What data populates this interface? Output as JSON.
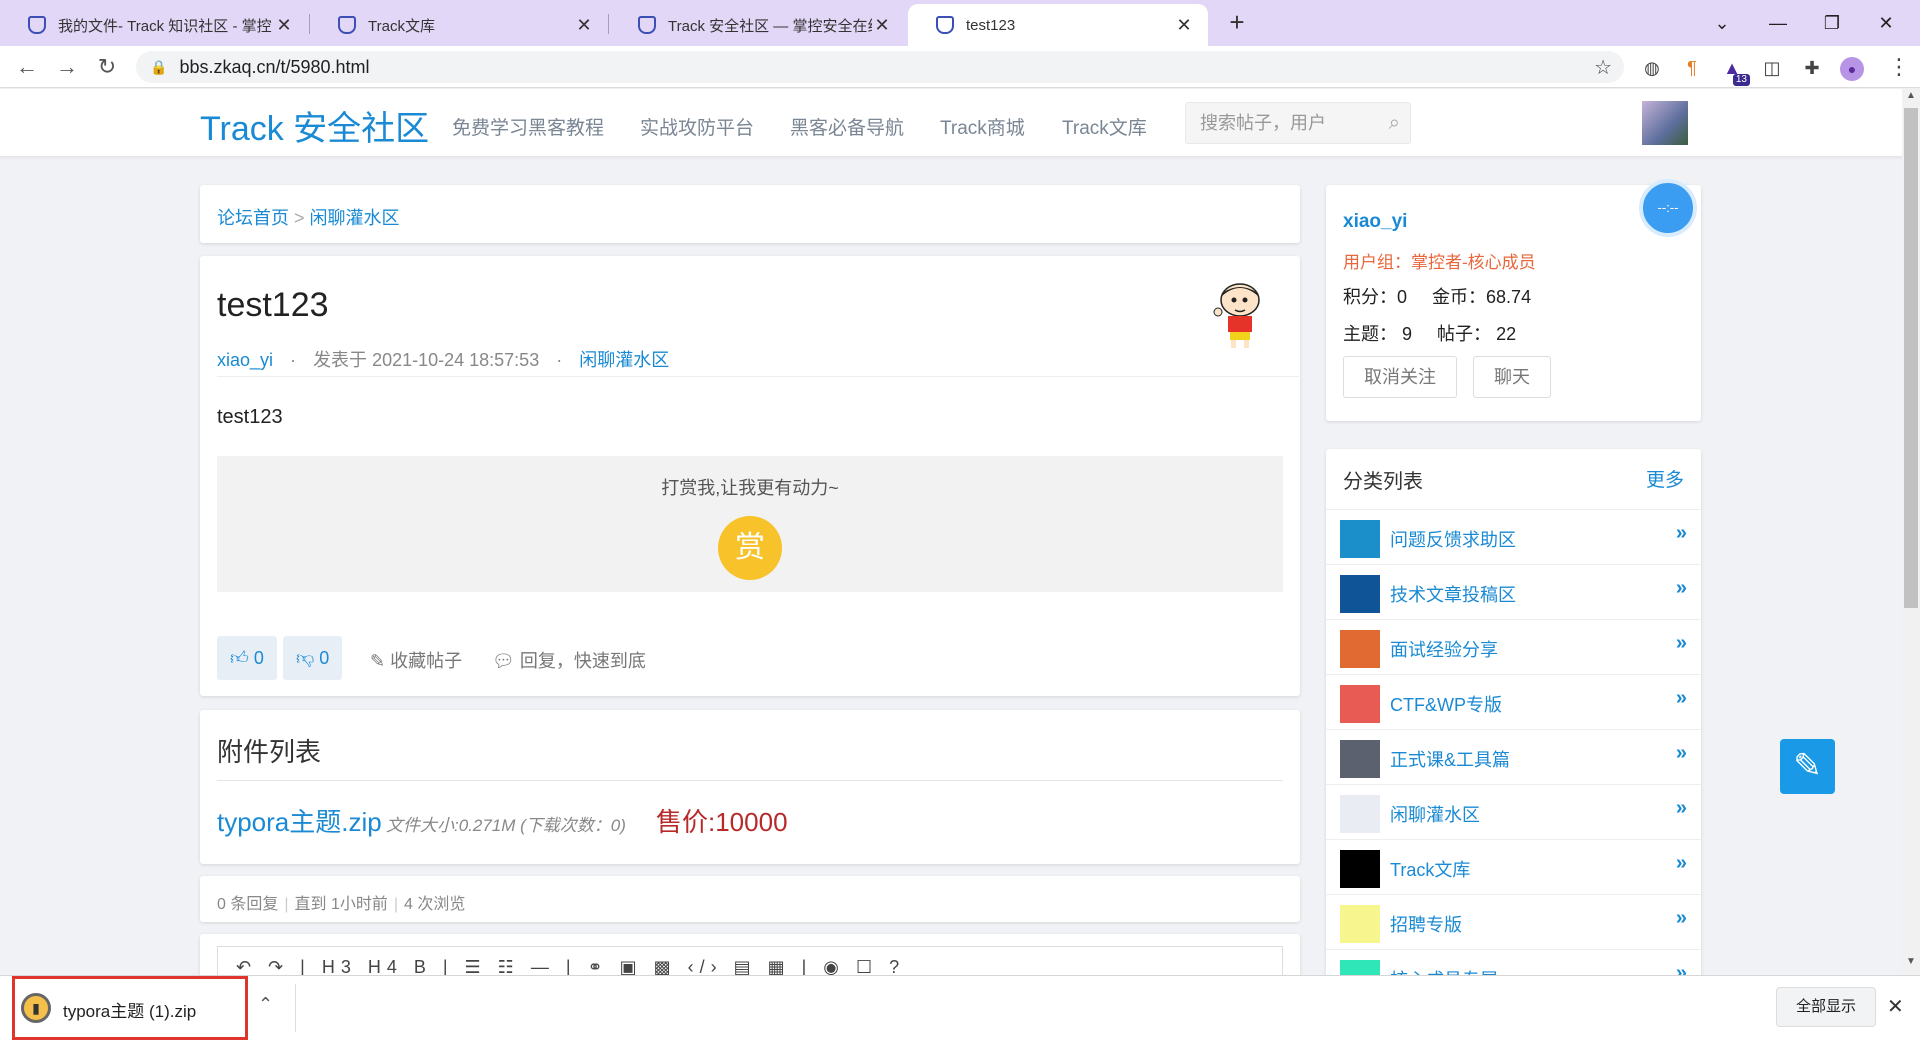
{
  "browser": {
    "tabs": [
      {
        "label": "我的文件- Track 知识社区 - 掌控",
        "close": "✕"
      },
      {
        "label": "Track文库",
        "close": "✕"
      },
      {
        "label": "Track 安全社区 — 掌控安全在线",
        "close": "✕"
      },
      {
        "label": "test123",
        "close": "✕"
      }
    ],
    "new_tab": "+",
    "url": "bbs.zkaq.cn/t/5980.html",
    "extension_badge": "13"
  },
  "site": {
    "logo": "Track 安全社区",
    "nav": [
      "免费学习黑客教程",
      "实战攻防平台",
      "黑客必备导航",
      "Track商城",
      "Track文库"
    ],
    "search_placeholder": "搜索帖子，用户"
  },
  "breadcrumb": {
    "home": "论坛首页",
    "sep": ">",
    "section": "闲聊灌水区"
  },
  "post": {
    "title": "test123",
    "author": "xiao_yi",
    "dot": "·",
    "published": "发表于 2021-10-24 18:57:53",
    "section": "闲聊灌水区",
    "body": "test123",
    "reward_text": "打赏我,让我更有动力~",
    "reward_button": "赏",
    "likes": "0",
    "dislikes": "0",
    "favorite": "收藏帖子",
    "reply": "回复，快速到底"
  },
  "attachments": {
    "title": "附件列表",
    "file_name": "typora主题.zip",
    "file_info": "文件大小:0.271M (下载次数：0)",
    "price": "售价:10000"
  },
  "stats": {
    "replies": "0 条回复",
    "time": "直到 1小时前",
    "views": "4 次浏览",
    "sep": "|"
  },
  "editor": {
    "toolbar": "↶ ↷ | H3 H4 B | ☰ ☷ — | ⚭ ▣ ▩ ‹/› ▤ ▦ | ◉ ☐ ?"
  },
  "user": {
    "name": "xiao_yi",
    "group": "用户组：掌控者-核心成员",
    "points_label": "积分：",
    "points": "0",
    "coins_label": "金币：",
    "coins": "68.74",
    "topics_label": "主题：",
    "topics": "9",
    "posts_label": "帖子：",
    "posts": "22",
    "unfollow": "取消关注",
    "chat": "聊天",
    "badge": "--:--"
  },
  "categories": {
    "title": "分类列表",
    "more": "更多",
    "items": [
      {
        "label": "问题反馈求助区",
        "color": "#1b8fc9"
      },
      {
        "label": "技术文章投稿区",
        "color": "#0e5496"
      },
      {
        "label": "面试经验分享",
        "color": "#e06a32"
      },
      {
        "label": "CTF&WP专版",
        "color": "#e85b55"
      },
      {
        "label": "正式课&工具篇",
        "color": "#5c6170"
      },
      {
        "label": "闲聊灌水区",
        "color": "#e9edf3"
      },
      {
        "label": "Track文库",
        "color": "#000000"
      },
      {
        "label": "招聘专版",
        "color": "#f6f58e"
      },
      {
        "label": "核心成员专属",
        "color": "#2ee6b8"
      }
    ]
  },
  "download": {
    "file": "typora主题 (1).zip",
    "show_all": "全部显示",
    "close": "✕"
  }
}
